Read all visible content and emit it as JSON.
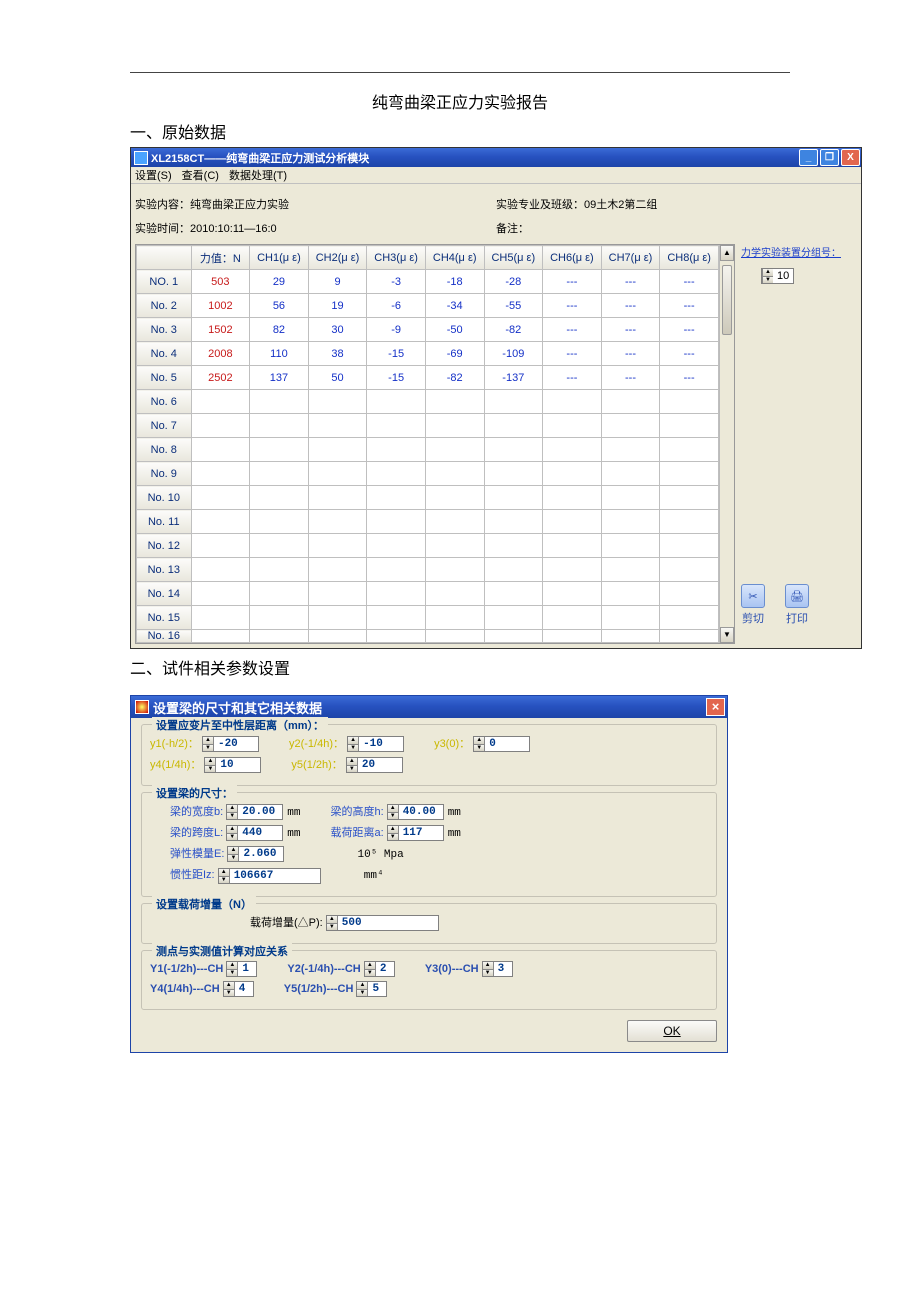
{
  "doc": {
    "title": "纯弯曲梁正应力实验报告",
    "section1": "一、原始数据",
    "section2": "二、试件相关参数设置"
  },
  "app": {
    "titlebar": "XL2158CT——纯弯曲梁正应力测试分析模块",
    "menu": [
      "设置(S)",
      "查看(C)",
      "数据处理(T)"
    ],
    "meta": {
      "content_label": "实验内容：",
      "content_value": "纯弯曲梁正应力实验",
      "class_label": "实验专业及班级：",
      "class_value": "09土木2第二组",
      "time_label": "实验时间：",
      "time_value": "2010:10:11—16:0",
      "remark_label": "备注："
    },
    "grid": {
      "headers": [
        "",
        "力值：N",
        "CH1(μ ε)",
        "CH2(μ ε)",
        "CH3(μ ε)",
        "CH4(μ ε)",
        "CH5(μ ε)",
        "CH6(μ ε)",
        "CH7(μ ε)",
        "CH8(μ ε)"
      ],
      "rows": [
        {
          "head": "NO. 1",
          "force": "503",
          "c": [
            "29",
            "9",
            "-3",
            "-18",
            "-28",
            "---",
            "---",
            "---"
          ]
        },
        {
          "head": "No. 2",
          "force": "1002",
          "c": [
            "56",
            "19",
            "-6",
            "-34",
            "-55",
            "---",
            "---",
            "---"
          ]
        },
        {
          "head": "No. 3",
          "force": "1502",
          "c": [
            "82",
            "30",
            "-9",
            "-50",
            "-82",
            "---",
            "---",
            "---"
          ]
        },
        {
          "head": "No. 4",
          "force": "2008",
          "c": [
            "110",
            "38",
            "-15",
            "-69",
            "-109",
            "---",
            "---",
            "---"
          ]
        },
        {
          "head": "No. 5",
          "force": "2502",
          "c": [
            "137",
            "50",
            "-15",
            "-82",
            "-137",
            "---",
            "---",
            "---"
          ]
        },
        {
          "head": "No. 6",
          "force": "",
          "c": [
            "",
            "",
            "",
            "",
            "",
            "",
            "",
            ""
          ]
        },
        {
          "head": "No. 7",
          "force": "",
          "c": [
            "",
            "",
            "",
            "",
            "",
            "",
            "",
            ""
          ]
        },
        {
          "head": "No. 8",
          "force": "",
          "c": [
            "",
            "",
            "",
            "",
            "",
            "",
            "",
            ""
          ]
        },
        {
          "head": "No. 9",
          "force": "",
          "c": [
            "",
            "",
            "",
            "",
            "",
            "",
            "",
            ""
          ]
        },
        {
          "head": "No. 10",
          "force": "",
          "c": [
            "",
            "",
            "",
            "",
            "",
            "",
            "",
            ""
          ]
        },
        {
          "head": "No. 11",
          "force": "",
          "c": [
            "",
            "",
            "",
            "",
            "",
            "",
            "",
            ""
          ]
        },
        {
          "head": "No. 12",
          "force": "",
          "c": [
            "",
            "",
            "",
            "",
            "",
            "",
            "",
            ""
          ]
        },
        {
          "head": "No. 13",
          "force": "",
          "c": [
            "",
            "",
            "",
            "",
            "",
            "",
            "",
            ""
          ]
        },
        {
          "head": "No. 14",
          "force": "",
          "c": [
            "",
            "",
            "",
            "",
            "",
            "",
            "",
            ""
          ]
        },
        {
          "head": "No. 15",
          "force": "",
          "c": [
            "",
            "",
            "",
            "",
            "",
            "",
            "",
            ""
          ]
        },
        {
          "head": "No. 16",
          "force": "",
          "c": [
            "",
            "",
            "",
            "",
            "",
            "",
            "",
            ""
          ]
        }
      ]
    },
    "side": {
      "link": "力学实验装置分组号：",
      "group_value": "10",
      "cut": "剪切",
      "print": "打印"
    }
  },
  "dialog": {
    "title": "设置梁的尺寸和其它相关数据",
    "fs1_legend": "设置应变片至中性层距离（mm）：",
    "y1_label": "y1(-h/2)：",
    "y1": "-20",
    "y2_label": "y2(-1/4h)：",
    "y2": "-10",
    "y3_label": "y3(0)：",
    "y3": "0",
    "y4_label": "y4(1/4h)：",
    "y4": "10",
    "y5_label": "y5(1/2h)：",
    "y5": "20",
    "fs2_legend": "设置梁的尺寸：",
    "b_label": "梁的宽度b:",
    "b": "20.00",
    "mm": "mm",
    "h_label": "梁的高度h:",
    "h": "40.00",
    "L_label": "梁的跨度L:",
    "L": "440",
    "a_label": "载荷距离a:",
    "a": "117",
    "E_label": "弹性模量E:",
    "E": "2.060",
    "E_unit": "10⁵  Mpa",
    "Iz_label": "惯性距Iz:",
    "Iz": "106667",
    "Iz_unit": "mm⁴",
    "fs3_legend": "设置载荷增量（N）",
    "dp_label": "载荷增量(△P):",
    "dp": "500",
    "fs4_legend": "测点与实测值计算对应关系",
    "m1_label": "Y1(-1/2h)---CH",
    "m1": "1",
    "m2_label": "Y2(-1/4h)---CH",
    "m2": "2",
    "m3_label": "Y3(0)---CH",
    "m3": "3",
    "m4_label": "Y4(1/4h)---CH",
    "m4": "4",
    "m5_label": "Y5(1/2h)---CH",
    "m5": "5",
    "ok": "OK"
  }
}
